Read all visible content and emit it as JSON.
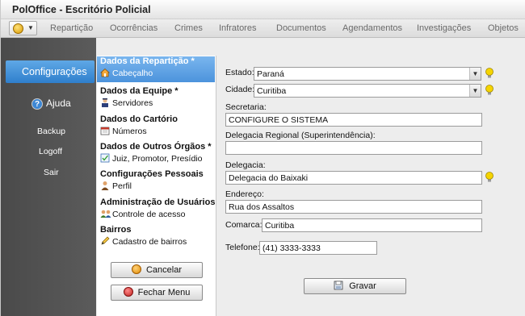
{
  "window": {
    "title": "PolOffice - Escritório Policial"
  },
  "menu": {
    "items": [
      "Repartição",
      "Ocorrências",
      "Crimes",
      "Infratores",
      "Documentos",
      "Agendamentos",
      "Investigações",
      "Objetos"
    ]
  },
  "leftnav": {
    "config_label": "Configurações",
    "help_label": "Ajuda",
    "links": [
      "Backup",
      "Logoff",
      "Sair"
    ]
  },
  "sections": [
    {
      "header": "Dados da Repartição *",
      "sub": "Cabeçalho",
      "icon": "house-icon",
      "active": true
    },
    {
      "header": "Dados da Equipe *",
      "sub": "Servidores",
      "icon": "officer-icon"
    },
    {
      "header": "Dados do Cartório",
      "sub": "Números",
      "icon": "calendar-icon"
    },
    {
      "header": "Dados de Outros Órgãos *",
      "sub": "Juiz, Promotor, Presídio",
      "icon": "checklist-icon"
    },
    {
      "header": "Configurações Pessoais",
      "sub": "Perfil",
      "icon": "person-icon"
    },
    {
      "header": "Administração de Usuários",
      "sub": "Controle de acesso",
      "icon": "users-icon"
    },
    {
      "header": "Bairros",
      "sub": "Cadastro de bairros",
      "icon": "pencil-icon"
    }
  ],
  "buttons": {
    "cancel": "Cancelar",
    "close_menu": "Fechar Menu",
    "save": "Gravar"
  },
  "form": {
    "estado_label": "Estado:",
    "estado_value": "Paraná",
    "cidade_label": "Cidade:",
    "cidade_value": "Curitiba",
    "secretaria_label": "Secretaria:",
    "secretaria_value": "CONFIGURE O SISTEMA",
    "delegacia_regional_label": "Delegacia Regional (Superintendência):",
    "delegacia_regional_value": "",
    "delegacia_label": "Delegacia:",
    "delegacia_value": "Delegacia do Baixaki",
    "endereco_label": "Endereço:",
    "endereco_value": "Rua dos Assaltos",
    "comarca_label": "Comarca:",
    "comarca_value": "Curitiba",
    "telefone_label": "Telefone:",
    "telefone_value": "(41) 3333-3333"
  },
  "colors": {
    "accent": "#3b8ad8",
    "nav_bg": "#505050",
    "bulb": "#f5d400"
  }
}
